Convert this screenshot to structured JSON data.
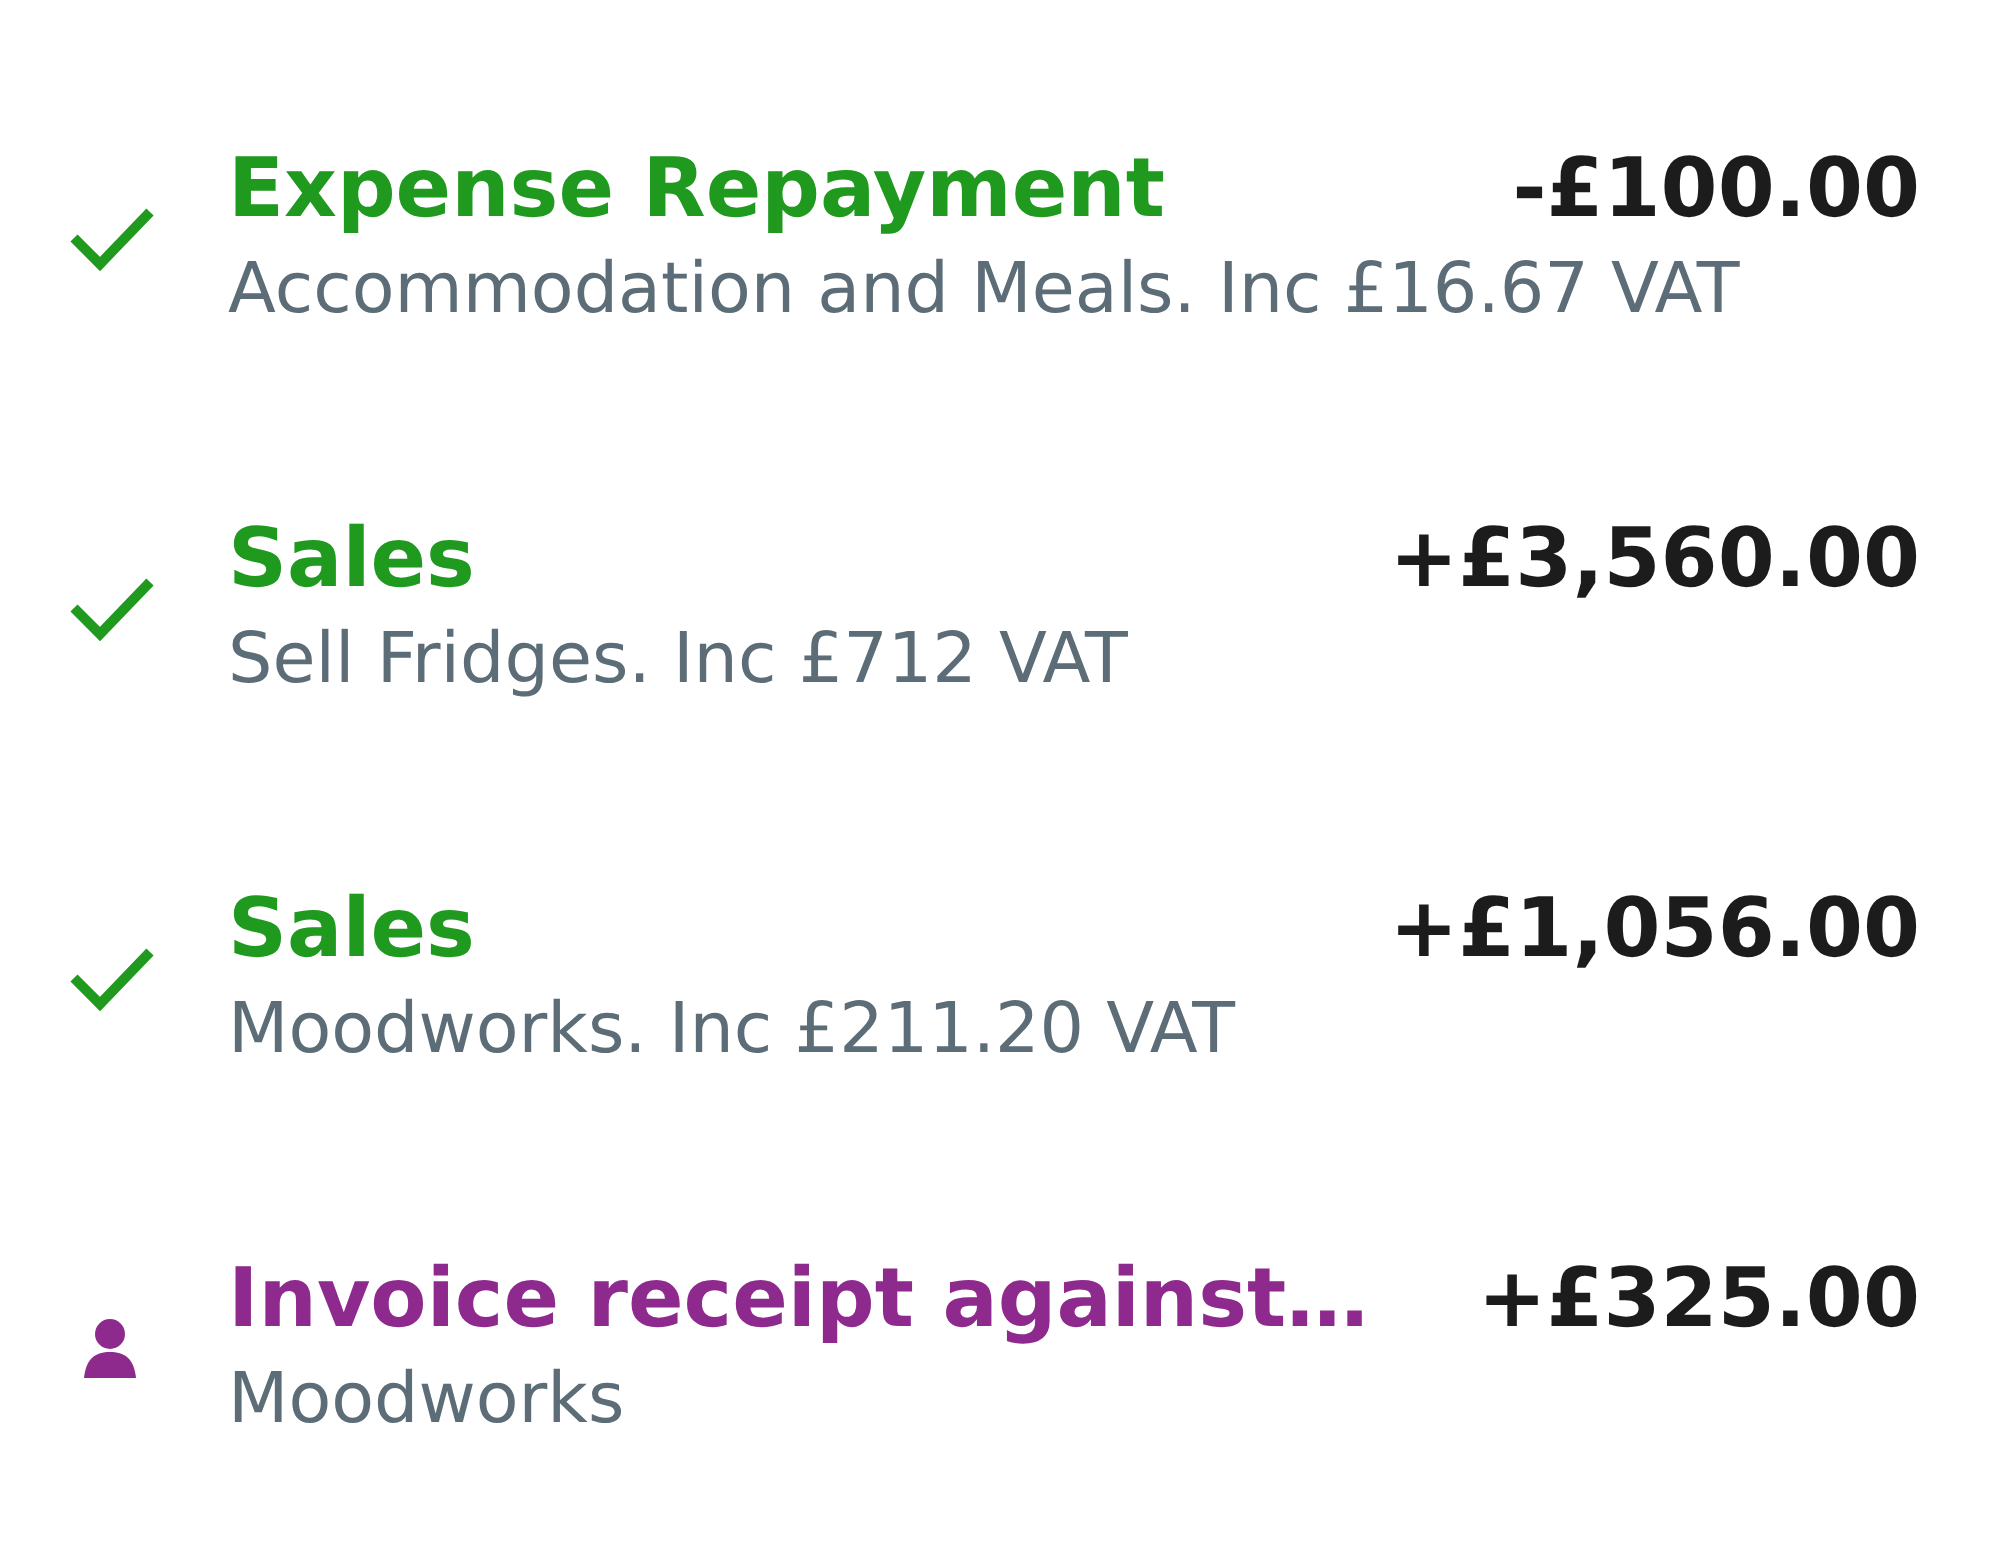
{
  "transactions": [
    {
      "kind": "reconciled",
      "title": "Expense Repayment",
      "detail": "Accommodation and Meals. Inc £16.67 VAT",
      "amount": "-£100.00"
    },
    {
      "kind": "reconciled",
      "title": "Sales",
      "detail": "Sell Fridges. Inc £712 VAT",
      "amount": "+£3,560.00"
    },
    {
      "kind": "reconciled",
      "title": "Sales",
      "detail": "Moodworks. Inc £211.20 VAT",
      "amount": "+£1,056.00"
    },
    {
      "kind": "contact",
      "title": "Invoice receipt against…",
      "detail": "Moodworks",
      "amount": "+£325.00"
    }
  ]
}
